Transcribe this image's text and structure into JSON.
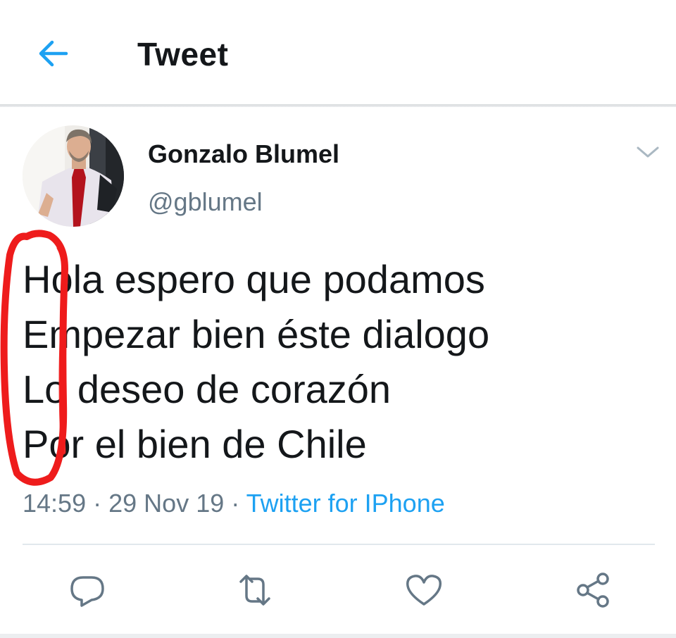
{
  "header": {
    "title": "Tweet",
    "back_icon": "back-arrow-icon",
    "accent_color": "#1da1f2"
  },
  "tweet": {
    "author_name": "Gonzalo Blumel",
    "author_handle": "@gblumel",
    "lines": [
      "Hola espero que podamos",
      "Empezar bien éste dialogo",
      "Lo deseo de corazón",
      "Por el bien de Chile"
    ],
    "time": "14:59",
    "date": "29 Nov 19",
    "separator": "·",
    "source": "Twitter for IPhone"
  },
  "annotation": {
    "type": "hand-drawn red circle around first letters",
    "color": "#ee1c1c"
  },
  "actions": [
    {
      "name": "reply",
      "icon": "reply-icon"
    },
    {
      "name": "retweet",
      "icon": "retweet-icon"
    },
    {
      "name": "like",
      "icon": "heart-icon"
    },
    {
      "name": "share",
      "icon": "share-icon"
    }
  ],
  "colors": {
    "text": "#14171a",
    "secondary": "#657786",
    "link": "#1da1f2",
    "divider": "#e1e8ed"
  }
}
